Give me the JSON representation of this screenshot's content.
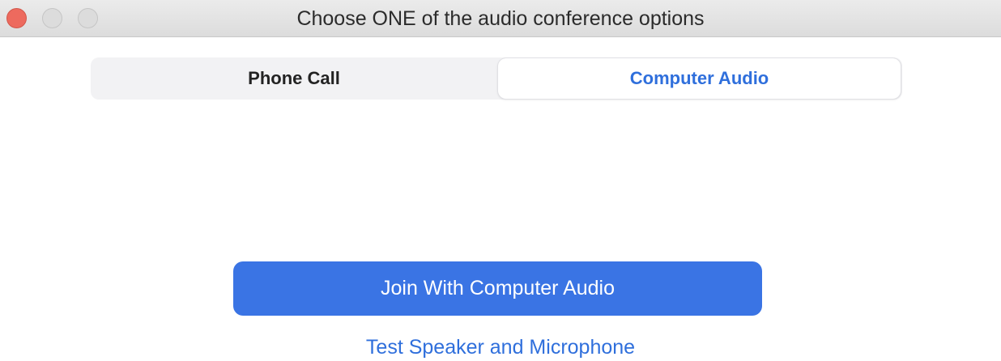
{
  "window": {
    "title": "Choose ONE of the audio conference options",
    "traffic_lights": [
      "close",
      "minimize",
      "zoom"
    ]
  },
  "tabs": {
    "items": [
      {
        "label": "Phone Call",
        "selected": false
      },
      {
        "label": "Computer Audio",
        "selected": true
      }
    ]
  },
  "actions": {
    "join_label": "Join With Computer Audio",
    "test_label": "Test Speaker and Microphone"
  },
  "colors": {
    "accent": "#3a74e4",
    "link": "#2f6fdc",
    "close": "#ed6a5e",
    "inactive_light": "#dcdcdc"
  }
}
